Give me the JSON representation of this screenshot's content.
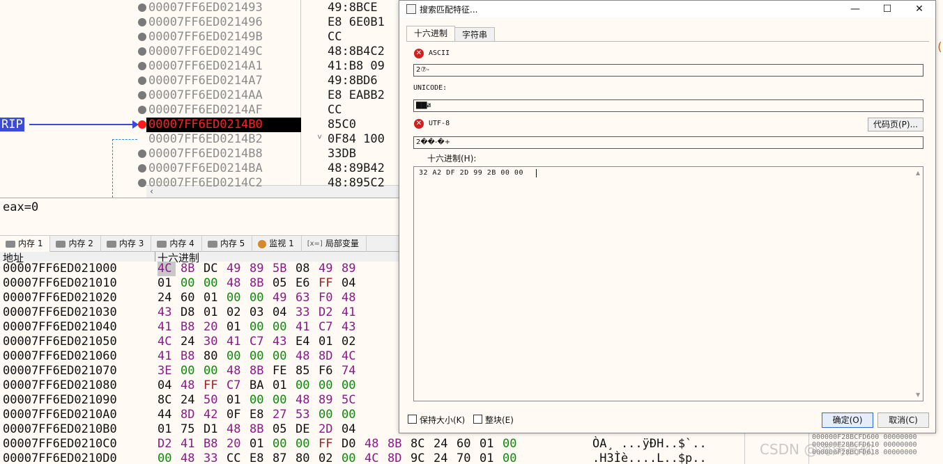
{
  "disasm": {
    "rows": [
      {
        "addr": "00007FF6ED021493",
        "bytes": "49:8BCE"
      },
      {
        "addr": "00007FF6ED021496",
        "bytes": "E8 6E0B1"
      },
      {
        "addr": "00007FF6ED02149B",
        "bytes": "CC"
      },
      {
        "addr": "00007FF6ED02149C",
        "bytes": "48:8B4C2"
      },
      {
        "addr": "00007FF6ED0214A1",
        "bytes": "41:B8 09"
      },
      {
        "addr": "00007FF6ED0214A7",
        "bytes": "49:8BD6"
      },
      {
        "addr": "00007FF6ED0214AA",
        "bytes": "E8 EABB2"
      },
      {
        "addr": "00007FF6ED0214AF",
        "bytes": "CC"
      },
      {
        "addr": "00007FF6ED0214B0",
        "bytes": "85C0"
      },
      {
        "addr": "00007FF6ED0214B2",
        "bytes": "0F84 100"
      },
      {
        "addr": "00007FF6ED0214B8",
        "bytes": "33DB"
      },
      {
        "addr": "00007FF6ED0214BA",
        "bytes": "48:89B42"
      },
      {
        "addr": "00007FF6ED0214C2",
        "bytes": "48:895C2"
      }
    ],
    "rip_label": "RIP",
    "jump_mark": "˅",
    "scroll_arrow": "‹"
  },
  "info": {
    "text": "eax=0"
  },
  "memory_tabs": [
    {
      "label": "内存 1",
      "icon": "memory-icon"
    },
    {
      "label": "内存 2",
      "icon": "memory-icon"
    },
    {
      "label": "内存 3",
      "icon": "memory-icon"
    },
    {
      "label": "内存 4",
      "icon": "memory-icon"
    },
    {
      "label": "内存 5",
      "icon": "memory-icon"
    },
    {
      "label": "监视 1",
      "icon": "watch-icon"
    },
    {
      "label": "局部变量",
      "icon": "locals-icon",
      "icon_text": "[x=]"
    }
  ],
  "dump": {
    "header_addr": "地址",
    "header_hex": "十六进制",
    "rows": [
      {
        "addr": "00007FF6ED021000",
        "hex": [
          "4C",
          "8B",
          "DC",
          "49",
          "89",
          "5B",
          "08",
          "49",
          "89"
        ]
      },
      {
        "addr": "00007FF6ED021010",
        "hex": [
          "01",
          "00",
          "00",
          "48",
          "8B",
          "05",
          "E6",
          "FF",
          "04"
        ]
      },
      {
        "addr": "00007FF6ED021020",
        "hex": [
          "24",
          "60",
          "01",
          "00",
          "00",
          "49",
          "63",
          "F0",
          "48"
        ]
      },
      {
        "addr": "00007FF6ED021030",
        "hex": [
          "43",
          "D8",
          "01",
          "02",
          "03",
          "04",
          "33",
          "D2",
          "41"
        ]
      },
      {
        "addr": "00007FF6ED021040",
        "hex": [
          "41",
          "B8",
          "20",
          "01",
          "00",
          "00",
          "41",
          "C7",
          "43"
        ]
      },
      {
        "addr": "00007FF6ED021050",
        "hex": [
          "4C",
          "24",
          "30",
          "41",
          "C7",
          "43",
          "E4",
          "01",
          "02"
        ]
      },
      {
        "addr": "00007FF6ED021060",
        "hex": [
          "41",
          "B8",
          "80",
          "00",
          "00",
          "00",
          "48",
          "8D",
          "4C"
        ]
      },
      {
        "addr": "00007FF6ED021070",
        "hex": [
          "3E",
          "00",
          "00",
          "48",
          "8B",
          "FE",
          "85",
          "F6",
          "74"
        ]
      },
      {
        "addr": "00007FF6ED021080",
        "hex": [
          "04",
          "48",
          "FF",
          "C7",
          "BA",
          "01",
          "00",
          "00",
          "00"
        ]
      },
      {
        "addr": "00007FF6ED021090",
        "hex": [
          "8C",
          "24",
          "50",
          "01",
          "00",
          "00",
          "48",
          "89",
          "5C"
        ]
      },
      {
        "addr": "00007FF6ED0210A0",
        "hex": [
          "44",
          "8D",
          "42",
          "0F",
          "E8",
          "27",
          "53",
          "00",
          "00"
        ]
      },
      {
        "addr": "00007FF6ED0210B0",
        "hex": [
          "01",
          "75",
          "D1",
          "48",
          "8B",
          "05",
          "DE",
          "2D",
          "04"
        ]
      },
      {
        "addr": "00007FF6ED0210C0",
        "hex": [
          "D2",
          "41",
          "B8",
          "20",
          "01",
          "00",
          "00",
          "FF",
          "D0",
          "48",
          "8B",
          "8C",
          "24",
          "60",
          "01",
          "00"
        ],
        "ascii": "ÒA¸ ...ÿÐH..$`.."
      },
      {
        "addr": "00007FF6ED0210D0",
        "hex": [
          "00",
          "48",
          "33",
          "CC",
          "E8",
          "87",
          "80",
          "02",
          "00",
          "4C",
          "8D",
          "9C",
          "24",
          "70",
          "01",
          "00"
        ],
        "ascii": ".H3Ìè....L..$p.."
      }
    ]
  },
  "right_partial": {
    "orange_glyph": "(",
    "stack_lines": [
      "000000F28BCFD600 00000000",
      "000000F28BCFD610 00000000",
      "000000F28BCFD618 00000000"
    ]
  },
  "watermark": "CSDN @海涛高软",
  "dialog": {
    "title": "搜索匹配特征...",
    "window_controls": {
      "minimize": "—",
      "maximize": "☐",
      "close": "✕"
    },
    "tabs": [
      "十六进制",
      "字符串"
    ],
    "ascii_label": "ASCII",
    "ascii_value": "2⑦-",
    "unicode_label": "UNICODE:",
    "unicode_value": "▇▇ⱥ",
    "utf8_label": "UTF-8",
    "utf8_value": "2��-�+",
    "codepage_button": "代码页(P)...",
    "hex_label": "十六进制(H):",
    "hex_value": "32 A2 DF 2D 99 2B 00 00",
    "keep_size_label": "保持大小(K)",
    "entire_block_label": "整块(E)",
    "ok_button": "确定(O)",
    "cancel_button": "取消(C)",
    "error_glyph": "✕"
  }
}
